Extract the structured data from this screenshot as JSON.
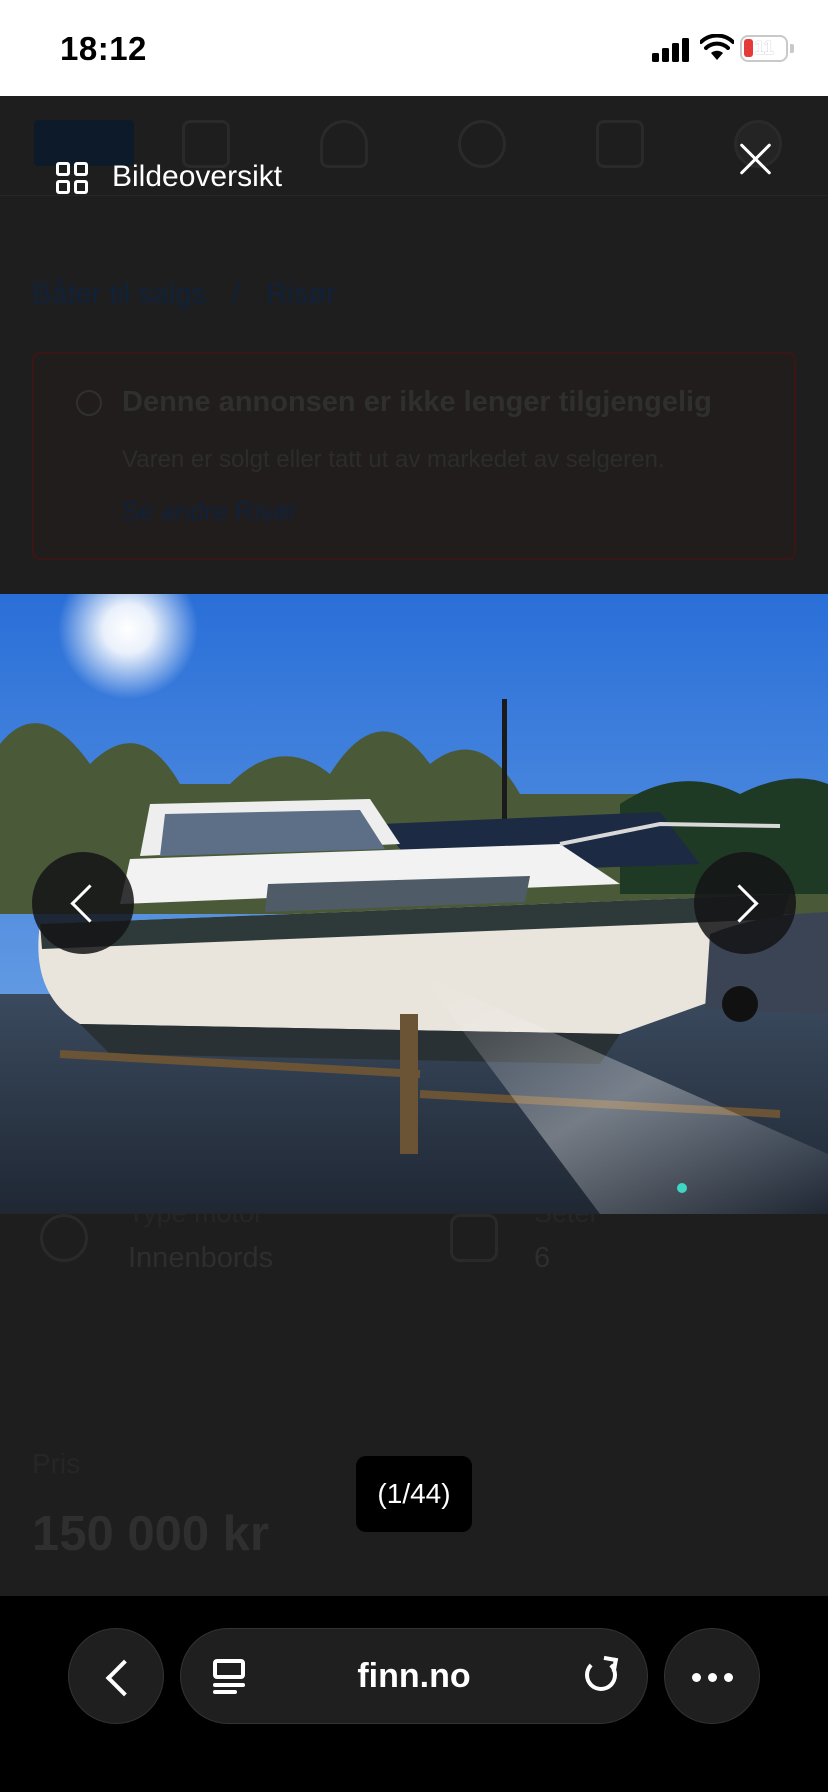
{
  "status_bar": {
    "time": "18:12",
    "battery_level": "11",
    "icons": [
      "signal-icon",
      "wifi-icon",
      "battery-icon"
    ]
  },
  "background_page": {
    "breadcrumb": [
      "Båter til salgs",
      "/",
      "Risør"
    ],
    "alert": {
      "title": "Denne annonsen er ikke lenger tilgjengelig",
      "text": "Varen er solgt eller tatt ut av markedet av selgeren.",
      "link": "Se andre Risør"
    },
    "specs": [
      {
        "label": "Type motor",
        "value": "Innenbords",
        "icon": "propeller-icon"
      },
      {
        "label": "Seter",
        "value": "6",
        "icon": "seat-icon"
      }
    ],
    "price_label": "Pris",
    "price": "150 000 kr"
  },
  "viewer": {
    "title": "Bildeoversikt",
    "counter": "(1/44)",
    "image_alt": "Båt på land – Risør 30 AC"
  },
  "browser": {
    "domain": "finn.no"
  },
  "colors": {
    "overlay_bg": "#1e1e1f",
    "sky": "#2e72d6",
    "text": "#ffffff"
  }
}
